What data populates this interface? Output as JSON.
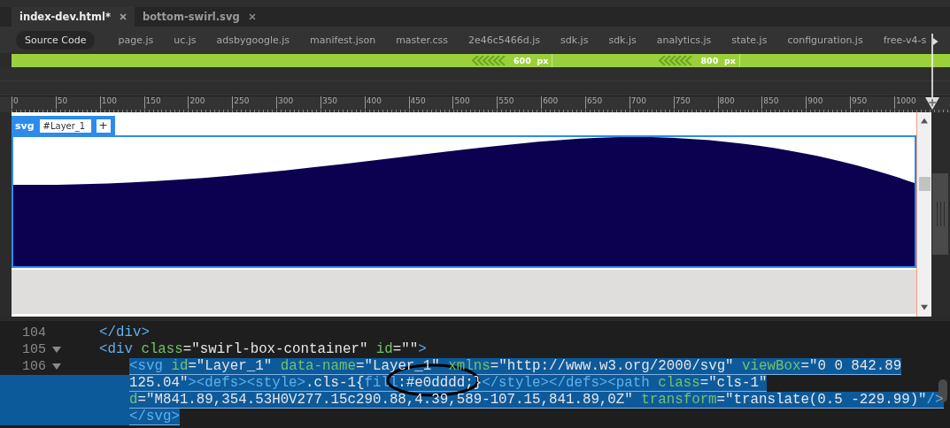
{
  "tabs": [
    {
      "label": "index-dev.html*",
      "selected": true
    },
    {
      "label": "bottom-swirl.svg",
      "selected": false
    }
  ],
  "related_files": {
    "source_button": "Source Code",
    "files": [
      "page.js",
      "uc.js",
      "adsbygoogle.js",
      "manifest.json",
      "master.css",
      "2e46c5466d.js",
      "sdk.js",
      "sdk.js",
      "analytics.js",
      "state.js",
      "configuration.js",
      "free-v4-s"
    ]
  },
  "media_queries": [
    {
      "value": "600",
      "unit": "px"
    },
    {
      "value": "800",
      "unit": "px"
    }
  ],
  "ruler": {
    "labels": [
      "0",
      "50",
      "100",
      "150",
      "200",
      "250",
      "300",
      "350",
      "400",
      "450",
      "500",
      "550",
      "600",
      "650",
      "700",
      "750",
      "800",
      "850",
      "900",
      "950",
      "1000"
    ]
  },
  "live_view": {
    "element_hud": {
      "tag": "svg",
      "selector": "#Layer_1",
      "add_button": "+"
    }
  },
  "code": {
    "lines": [
      {
        "number": "104",
        "foldable": false,
        "selected": false,
        "rows": [
          {
            "tokens": [
              {
                "kind": "tag",
                "text": "</div>"
              }
            ]
          }
        ]
      },
      {
        "number": "105",
        "foldable": true,
        "selected": false,
        "rows": [
          {
            "tokens": [
              {
                "kind": "tag",
                "text": "<div"
              },
              {
                "kind": "attr",
                "text": " class"
              },
              {
                "kind": "plain",
                "text": "="
              },
              {
                "kind": "str",
                "text": "\"swirl-box-container\""
              },
              {
                "kind": "attr",
                "text": " id"
              },
              {
                "kind": "plain",
                "text": "="
              },
              {
                "kind": "str",
                "text": "\"\""
              },
              {
                "kind": "tag",
                "text": ">"
              }
            ]
          }
        ],
        "children": [
          {
            "number": "106",
            "foldable": true,
            "selected": true,
            "rows": [
              {
                "tokens": [
                  {
                    "kind": "tag",
                    "text": "<svg"
                  },
                  {
                    "kind": "attr",
                    "text": " id"
                  },
                  {
                    "kind": "plain",
                    "text": "="
                  },
                  {
                    "kind": "str",
                    "text": "\"Layer_1\""
                  },
                  {
                    "kind": "attr",
                    "text": " data-name"
                  },
                  {
                    "kind": "plain",
                    "text": "="
                  },
                  {
                    "kind": "str",
                    "text": "\"Layer_1\""
                  },
                  {
                    "kind": "attr",
                    "text": " xmlns"
                  },
                  {
                    "kind": "plain",
                    "text": "="
                  },
                  {
                    "kind": "str",
                    "text": "\"http://www.w3.org/2000/svg\""
                  },
                  {
                    "kind": "attr",
                    "text": " viewBox"
                  },
                  {
                    "kind": "plain",
                    "text": "="
                  },
                  {
                    "kind": "str",
                    "text": "\"0 0 842.89"
                  }
                ]
              },
              {
                "tokens": [
                  {
                    "kind": "str",
                    "text": "125.04\""
                  },
                  {
                    "kind": "tag",
                    "text": "><defs><style>"
                  },
                  {
                    "kind": "plain",
                    "text": ".cls-1{"
                  },
                  {
                    "kind": "tag",
                    "text": "fill"
                  },
                  {
                    "kind": "plain",
                    "text": ":#e0dddd;}"
                  },
                  {
                    "kind": "tag",
                    "text": "</style></defs><path"
                  },
                  {
                    "kind": "attr",
                    "text": " class"
                  },
                  {
                    "kind": "plain",
                    "text": "="
                  },
                  {
                    "kind": "str",
                    "text": "\"cls-1\""
                  }
                ]
              },
              {
                "tokens": [
                  {
                    "kind": "attr",
                    "text": "d"
                  },
                  {
                    "kind": "plain",
                    "text": "="
                  },
                  {
                    "kind": "str",
                    "text": "\"M841.89,354.53H0V277.15c290.88,4.39,589-107.15,841.89,0Z\""
                  },
                  {
                    "kind": "attr",
                    "text": " transform"
                  },
                  {
                    "kind": "plain",
                    "text": "="
                  },
                  {
                    "kind": "str",
                    "text": "\"translate(0.5 -229.99)\""
                  },
                  {
                    "kind": "tag",
                    "text": "/>"
                  }
                ]
              },
              {
                "tokens": [
                  {
                    "kind": "tag",
                    "text": "</svg>"
                  }
                ]
              }
            ]
          }
        ]
      }
    ]
  }
}
